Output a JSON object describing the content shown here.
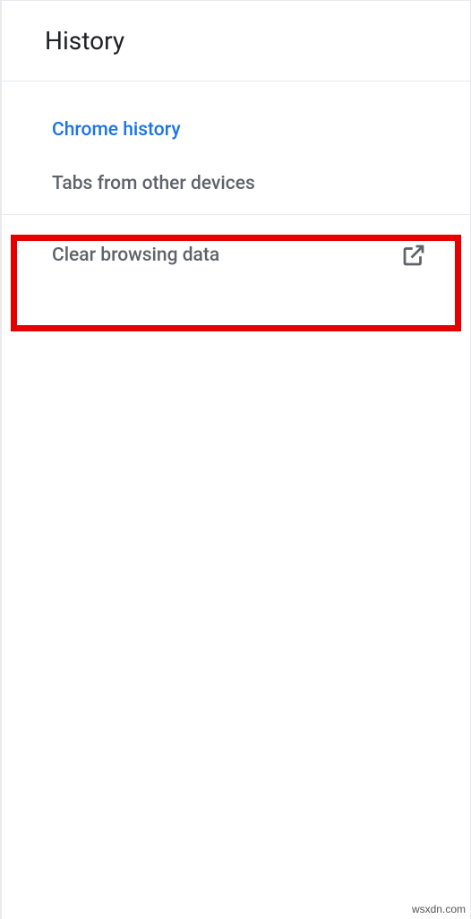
{
  "header": {
    "title": "History"
  },
  "menu": {
    "items": [
      {
        "label": "Chrome history",
        "selected": true
      },
      {
        "label": "Tabs from other devices",
        "selected": false
      }
    ]
  },
  "clear": {
    "label": "Clear browsing data"
  },
  "watermark": "wsxdn.com"
}
